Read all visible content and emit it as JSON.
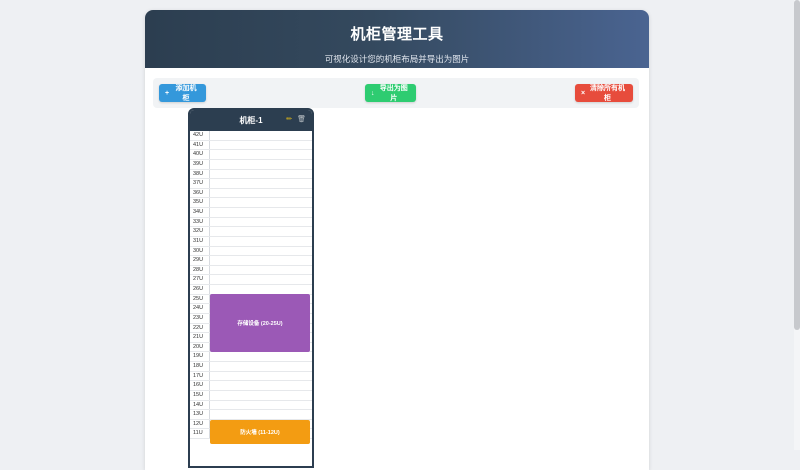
{
  "header": {
    "title": "机柜管理工具",
    "subtitle": "可视化设计您的机柜布局并导出为图片"
  },
  "toolbar": {
    "add_label": "添加机柜",
    "add_icon": "+",
    "export_label": "导出为图片",
    "export_icon": "↓",
    "clear_label": "清除所有机柜",
    "clear_icon": "×"
  },
  "cabinet": {
    "title": "机柜-1",
    "edit_icon": "✏",
    "delete_icon": "🗑",
    "units": [
      "42U",
      "41U",
      "40U",
      "39U",
      "38U",
      "37U",
      "36U",
      "35U",
      "34U",
      "33U",
      "32U",
      "31U",
      "30U",
      "29U",
      "28U",
      "27U",
      "26U",
      "25U",
      "24U",
      "23U",
      "22U",
      "21U",
      "20U",
      "19U",
      "18U",
      "17U",
      "16U",
      "15U",
      "14U",
      "13U",
      "12U",
      "11U"
    ],
    "devices": [
      {
        "label": "存储设备 (20-25U)",
        "color": "#9b59b6"
      },
      {
        "label": "防火墙 (11-12U)",
        "color": "#f39c12"
      }
    ]
  },
  "colors": {
    "header_start": "#2c3e50",
    "header_end": "#4a6491",
    "add_button": "#3498db",
    "export_button": "#2ecc71",
    "clear_button": "#e74c3c"
  }
}
